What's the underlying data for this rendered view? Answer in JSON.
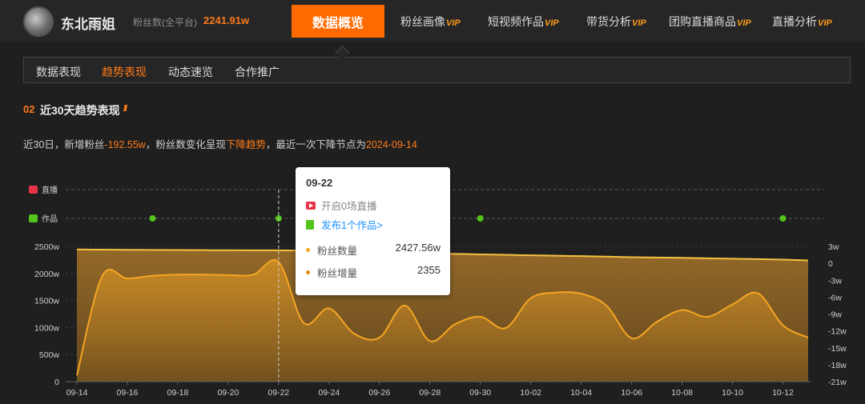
{
  "header": {
    "username": "东北雨姐",
    "fans_label": "粉丝数(全平台)",
    "fans_value": "2241.91w"
  },
  "nav": {
    "active": "数据概览",
    "items": [
      {
        "label": "粉丝画像",
        "vip": "VIP"
      },
      {
        "label": "短视频作品",
        "vip": "VIP"
      },
      {
        "label": "带货分析",
        "vip": "VIP"
      },
      {
        "label": "团购直播商品",
        "vip": "VIP"
      },
      {
        "label": "直播分析",
        "vip": "VIP"
      }
    ]
  },
  "subtabs": [
    "数据表现",
    "趋势表现",
    "动态速览",
    "合作推广"
  ],
  "section": {
    "number": "02",
    "title": "近30天趋势表现"
  },
  "summary": {
    "prefix": "近30日，新增粉丝",
    "new_fans": "-192.55w",
    "mid": "，粉丝数变化呈现",
    "trend": "下降趋势",
    "mid2": "，最近一次下降节点为",
    "last_drop_date": "2024-09-14"
  },
  "tooltip": {
    "date": "09-22",
    "live_text": "开启0场直播",
    "works_text": "发布1个作品>",
    "fans_total_label": "粉丝数量",
    "fans_total_value": "2427.56w",
    "fans_gain_label": "粉丝增量",
    "fans_gain_value": "2355"
  },
  "chart_data": {
    "type": "area",
    "event_rows": [
      "直播",
      "作品"
    ],
    "x_tick_labels": [
      "09-14",
      "09-16",
      "09-18",
      "09-20",
      "09-22",
      "09-24",
      "09-26",
      "09-28",
      "09-30",
      "10-02",
      "10-04",
      "10-06",
      "10-08",
      "10-10",
      "10-12"
    ],
    "work_post_dates": [
      "09-17",
      "09-22",
      "09-30",
      "10-12"
    ],
    "highlighted_date": "09-22",
    "y_left": {
      "ticks": [
        "0",
        "500w",
        "1000w",
        "1500w",
        "2000w",
        "2500w"
      ],
      "min": 0,
      "max": 2500,
      "unit": "w"
    },
    "y_right": {
      "ticks": [
        "3w",
        "0",
        "-3w",
        "-6w",
        "-9w",
        "-12w",
        "-15w",
        "-18w",
        "-21w"
      ],
      "min": -21,
      "max": 3,
      "unit": "w"
    },
    "colors": {
      "fans_total": "#f5c242",
      "fans_gain": "#f5a623"
    },
    "series": [
      {
        "name": "粉丝数量",
        "axis": "left",
        "points": [
          [
            "09-14",
            2445
          ],
          [
            "09-15",
            2440
          ],
          [
            "09-16",
            2437
          ],
          [
            "09-17",
            2435
          ],
          [
            "09-18",
            2433
          ],
          [
            "09-19",
            2431
          ],
          [
            "09-20",
            2429
          ],
          [
            "09-21",
            2428
          ],
          [
            "09-22",
            2427.56
          ],
          [
            "09-23",
            2420
          ],
          [
            "09-24",
            2410
          ],
          [
            "09-25",
            2400
          ],
          [
            "09-26",
            2390
          ],
          [
            "09-27",
            2380
          ],
          [
            "09-28",
            2372
          ],
          [
            "09-29",
            2362
          ],
          [
            "09-30",
            2352
          ],
          [
            "10-01",
            2345
          ],
          [
            "10-02",
            2335
          ],
          [
            "10-03",
            2328
          ],
          [
            "10-04",
            2320
          ],
          [
            "10-05",
            2312
          ],
          [
            "10-06",
            2300
          ],
          [
            "10-07",
            2295
          ],
          [
            "10-08",
            2290
          ],
          [
            "10-09",
            2280
          ],
          [
            "10-10",
            2272
          ],
          [
            "10-11",
            2265
          ],
          [
            "10-12",
            2255
          ],
          [
            "10-13",
            2242
          ]
        ]
      },
      {
        "name": "粉丝增量",
        "axis": "right",
        "points": [
          [
            "09-14",
            -19.9
          ],
          [
            "09-15",
            -2.3
          ],
          [
            "09-16",
            -2.7
          ],
          [
            "09-17",
            -2.2
          ],
          [
            "09-18",
            -2.0
          ],
          [
            "09-19",
            -2.0
          ],
          [
            "09-20",
            -2.1
          ],
          [
            "09-21",
            -2.0
          ],
          [
            "09-22",
            0.24
          ],
          [
            "09-23",
            -10.6
          ],
          [
            "09-24",
            -8.0
          ],
          [
            "09-25",
            -12.5
          ],
          [
            "09-26",
            -13.2
          ],
          [
            "09-27",
            -7.5
          ],
          [
            "09-28",
            -13.8
          ],
          [
            "09-29",
            -10.8
          ],
          [
            "09-30",
            -9.5
          ],
          [
            "10-01",
            -11.5
          ],
          [
            "10-02",
            -6.2
          ],
          [
            "10-03",
            -5.2
          ],
          [
            "10-04",
            -5.4
          ],
          [
            "10-05",
            -7.5
          ],
          [
            "10-06",
            -13.3
          ],
          [
            "10-07",
            -10.4
          ],
          [
            "10-08",
            -8.3
          ],
          [
            "10-09",
            -9.5
          ],
          [
            "10-10",
            -7.3
          ],
          [
            "10-11",
            -5.3
          ],
          [
            "10-12",
            -11.0
          ],
          [
            "10-13",
            -13.2
          ]
        ]
      }
    ]
  }
}
